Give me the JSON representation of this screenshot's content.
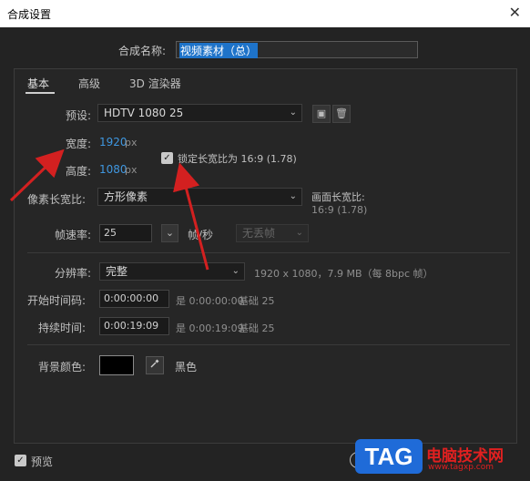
{
  "window": {
    "title": "合成设置",
    "close_glyph": "✕"
  },
  "name": {
    "label": "合成名称:",
    "value": "视频素材（总）"
  },
  "tabs": [
    {
      "label": "基本",
      "active": true
    },
    {
      "label": "高级",
      "active": false
    },
    {
      "label": "3D 渲染器",
      "active": false
    }
  ],
  "preset": {
    "label": "预设:",
    "value": "HDTV 1080 25"
  },
  "width": {
    "label": "宽度:",
    "value": "1920",
    "unit": "px"
  },
  "height": {
    "label": "高度:",
    "value": "1080",
    "unit": "px"
  },
  "lock_aspect": {
    "label": "锁定长宽比为 16:9 (1.78)",
    "checked": true
  },
  "pixel_aspect": {
    "label": "像素长宽比:",
    "value": "方形像素"
  },
  "frame_aspect": {
    "label": "画面长宽比:",
    "value": "16:9 (1.78)"
  },
  "frame_rate": {
    "label": "帧速率:",
    "value": "25",
    "unit": "帧/秒",
    "drop": "无丢帧"
  },
  "resolution": {
    "label": "分辨率:",
    "value": "完整",
    "info": "1920 x 1080，7.9 MB（每 8bpc 帧）"
  },
  "start_timecode": {
    "label": "开始时间码:",
    "value": "0:00:00:00",
    "info": "是 0:00:00:00",
    "base": "基础 25"
  },
  "duration": {
    "label": "持续时间:",
    "value": "0:00:19:09",
    "info": "是 0:00:19:09",
    "base": "基础 25"
  },
  "background": {
    "label": "背景颜色:",
    "color": "#000000",
    "name": "黑色"
  },
  "preview": {
    "label": "预览",
    "checked": true
  },
  "watermark": {
    "tag": "TAG",
    "text": "电脑技术网",
    "url": "www.tagxp.com"
  },
  "colors": {
    "accent": "#3f97e0",
    "arrow": "#d32020"
  }
}
